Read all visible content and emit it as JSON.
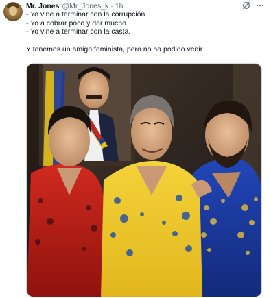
{
  "author": {
    "name": "Mr. Jones",
    "handle": "@Mr_Jones_k",
    "separator": "·",
    "time": "1h"
  },
  "icons": {
    "avatar": "avatar-icon",
    "grok": "grok-icon",
    "more": "more-icon"
  },
  "tweet": {
    "lines": [
      "- Yo vine a terminar con la corrupción.",
      "- Yo a cobrar poco y dar mucho.",
      "- Yo vine a terminar con la casta.",
      "Y tenemos un amigo feminista, pero no ha podido venir."
    ]
  },
  "colors": {
    "text": "#0f1419",
    "secondary": "#536471",
    "border": "#cfd9de"
  }
}
